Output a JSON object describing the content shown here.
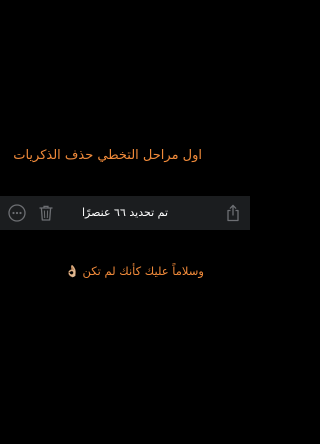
{
  "captions": {
    "top": "اول مراحل التخطي حذف الذكريات",
    "bottom": "وسلاماً عليك كأنك لم تكن",
    "bottom_emoji": "👌🏼"
  },
  "toolbar": {
    "selection_status": "تم تحديد ٦٦ عنصرًا",
    "icons": [
      "more-icon",
      "trash-icon",
      "share-icon"
    ]
  },
  "colors": {
    "background": "#000000",
    "caption_text": "#f08a3a",
    "toolbar_bg": "#1b1d1f",
    "toolbar_icon": "#6d6f73",
    "toolbar_text": "#ffffff"
  }
}
